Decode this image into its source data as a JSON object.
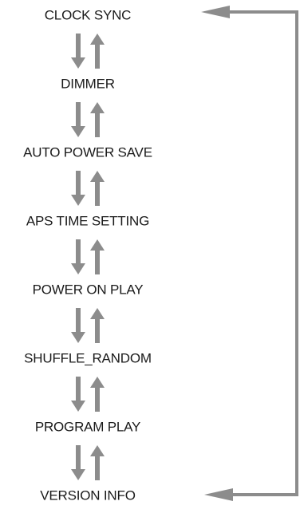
{
  "menu_items": [
    {
      "label": "CLOCK SYNC"
    },
    {
      "label": "DIMMER"
    },
    {
      "label": "AUTO POWER SAVE"
    },
    {
      "label": "APS TIME SETTING"
    },
    {
      "label": "POWER ON PLAY"
    },
    {
      "label": "SHUFFLE_RANDOM"
    },
    {
      "label": "PROGRAM PLAY"
    },
    {
      "label": "VERSION INFO"
    }
  ],
  "connector_icons": [
    "down-arrow-icon",
    "up-arrow-icon"
  ],
  "loop_icon": "loop-back-arrow-icon",
  "colors": {
    "text": "#1a1a1a",
    "arrow": "#8c8c8c",
    "background": "#ffffff"
  }
}
